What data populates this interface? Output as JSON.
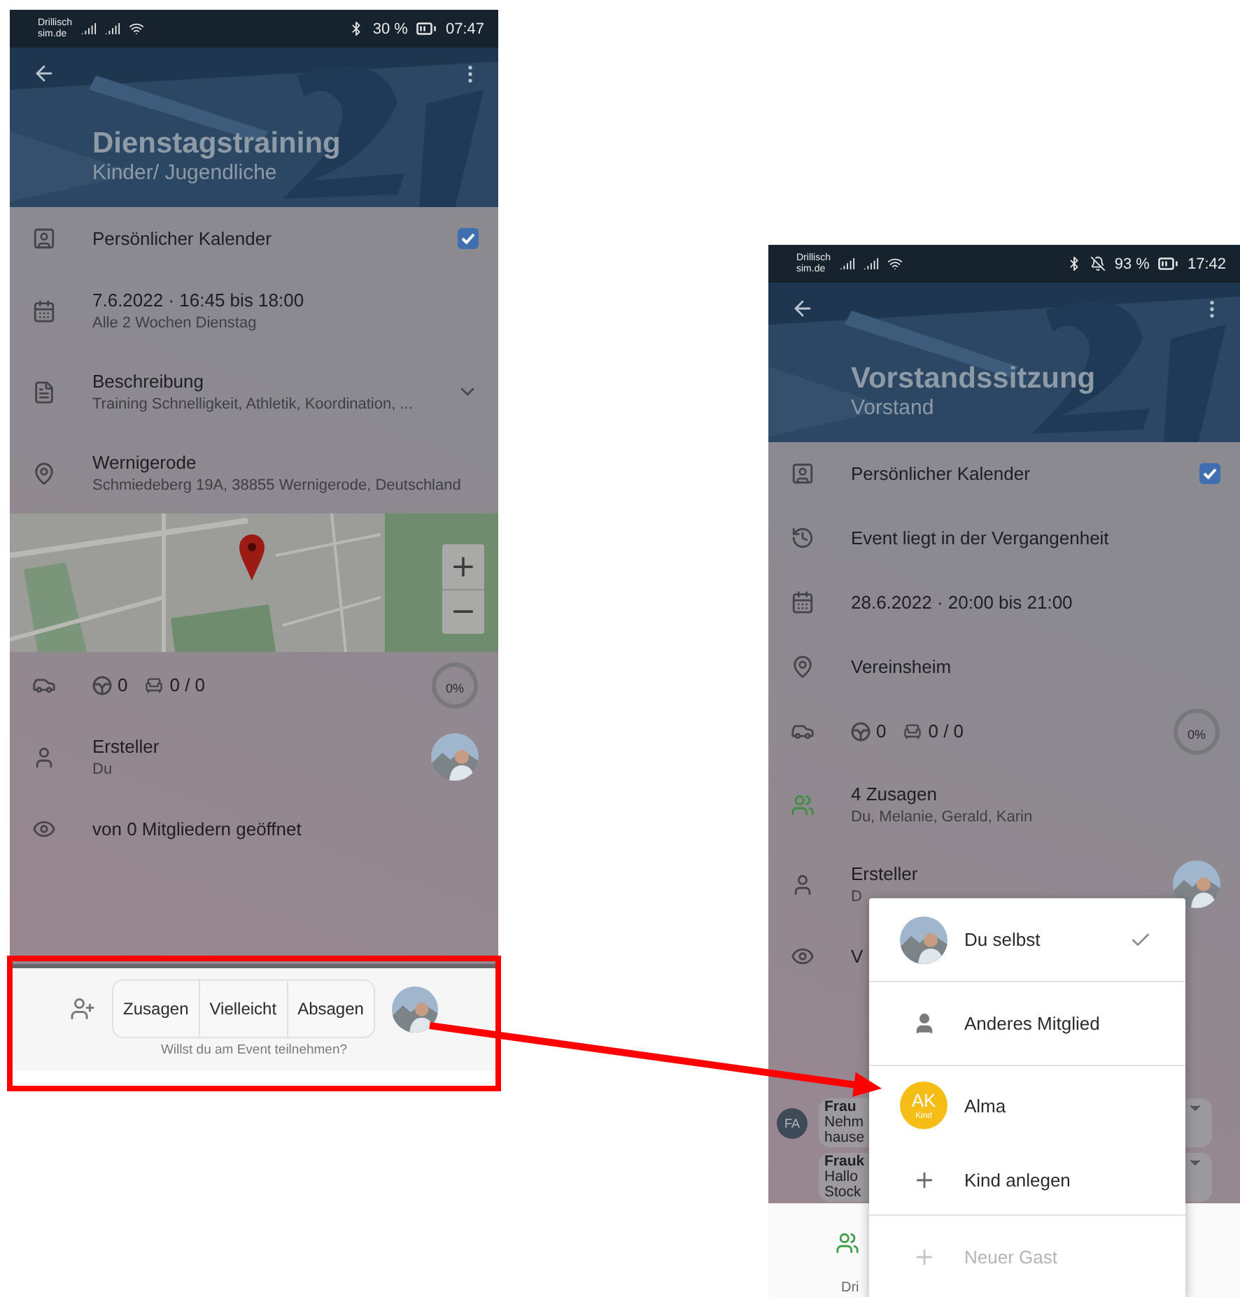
{
  "screens": [
    {
      "status_bar": {
        "carrier": "Drillisch",
        "carrier_domain": "sim.de",
        "silent": false,
        "battery": "30 %",
        "time": "07:47"
      },
      "header": {
        "title": "Dienstagstraining",
        "subtitle": "Kinder/ Jugendliche"
      },
      "rows": [
        {
          "kind": "check",
          "title": "Persönlicher Kalender",
          "checked": true
        },
        {
          "kind": "info",
          "title": "7.6.2022 · 16:45 bis 18:00",
          "subtitle": "Alle 2 Wochen Dienstag"
        },
        {
          "kind": "expand",
          "title": "Beschreibung",
          "subtitle": "Training Schnelligkeit, Athletik, Koordination, ...",
          "expanded": false
        },
        {
          "kind": "info",
          "title": "Wernigerode",
          "subtitle": "Schmiedeberg 19A, 38855 Wernigerode, Deutschland"
        },
        {
          "kind": "map",
          "zoom_in": "+",
          "zoom_out": "−"
        },
        {
          "kind": "rides",
          "drivers": "0",
          "seats": "0 / 0",
          "progress": "0%",
          "level": 0
        },
        {
          "kind": "creator",
          "title": "Ersteller",
          "subtitle": "Du"
        },
        {
          "kind": "info",
          "title": "von 0 Mitgliedern geöffnet"
        }
      ],
      "footer": {
        "kind": "rsvp",
        "buttons": [
          {
            "label": "Zusagen",
            "selected": false
          },
          {
            "label": "Vielleicht",
            "selected": false
          },
          {
            "label": "Absagen",
            "selected": false
          }
        ],
        "hint": "Willst du am Event teilnehmen?"
      }
    },
    {
      "status_bar": {
        "carrier": "Drillisch",
        "carrier_domain": "sim.de",
        "silent": true,
        "battery": "93 %",
        "time": "17:42"
      },
      "header": {
        "title": "Vorstandssitzung",
        "subtitle": "Vorstand"
      },
      "rows": [
        {
          "kind": "check",
          "title": "Persönlicher Kalender",
          "checked": true
        },
        {
          "kind": "info",
          "title": "Event liegt in der Vergangenheit"
        },
        {
          "kind": "info",
          "title": "28.6.2022 · 20:00 bis 21:00"
        },
        {
          "kind": "info",
          "title": "Vereinsheim"
        },
        {
          "kind": "rides",
          "drivers": "0",
          "seats": "0 / 0",
          "progress": "0%",
          "level": 0
        },
        {
          "kind": "info",
          "title": "4 Zusagen",
          "subtitle": "Du, Melanie, Gerald, Karin"
        },
        {
          "kind": "creator",
          "title": "Ersteller",
          "subtitle": "D"
        },
        {
          "kind": "info",
          "title": "V"
        }
      ],
      "comments": [
        {
          "initials": "FA",
          "lines": [
            "Frau",
            "Nehm",
            "hause"
          ]
        },
        {
          "lines": [
            "Frauk",
            "Hallo",
            "Stock"
          ]
        }
      ],
      "footer": {
        "kind": "tabs",
        "label": "Dri"
      },
      "menu": {
        "items": [
          {
            "kind": "avatar",
            "label": "Du selbst",
            "selected": true,
            "disabled": false
          },
          {
            "kind": "person",
            "label": "Anderes Mitglied",
            "selected": false,
            "disabled": false
          },
          {
            "kind": "initials",
            "initials": "AK",
            "tag": "Kind",
            "label": "Alma",
            "selected": false,
            "disabled": false
          },
          {
            "kind": "add",
            "label": "Kind anlegen",
            "selected": false,
            "disabled": false
          },
          {
            "kind": "add",
            "label": "Neuer Gast",
            "selected": false,
            "disabled": true
          }
        ]
      }
    }
  ]
}
